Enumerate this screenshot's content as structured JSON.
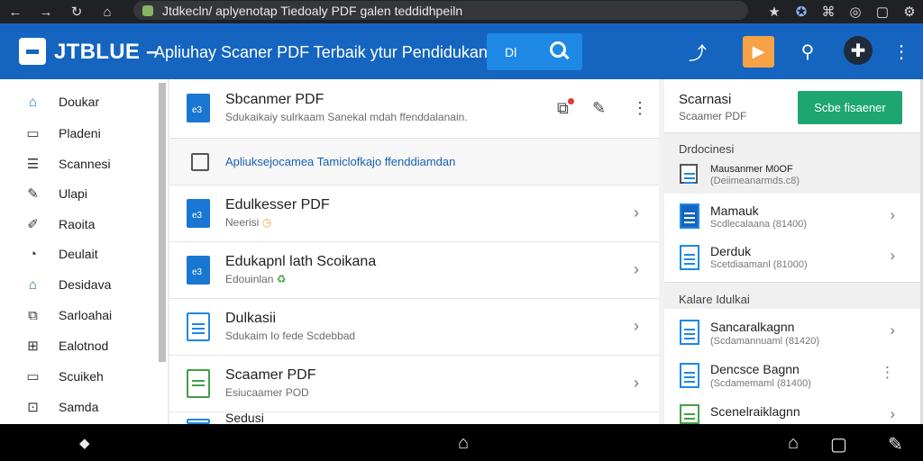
{
  "browser": {
    "back": "←",
    "forward": "→",
    "reload": "↻",
    "home": "⌂",
    "url": "Jtdkecln/ aplyenotap Tiedoaly PDF galen teddidhpeiln",
    "tools": [
      "★",
      "✪",
      "⌘",
      "◎",
      "▢",
      "⚙"
    ]
  },
  "app": {
    "brand": "JTBLUE –",
    "tagline": "Apliuhay Scaner PDF Terbaik ytur Pendidukan",
    "search_label": "Dl",
    "header_icons": {
      "share": "⤴",
      "orange": "▶",
      "key": "⚲",
      "puzzle": "✚",
      "more": "⋮"
    }
  },
  "sidebar": {
    "items": [
      {
        "label": "Doukar",
        "icon": "⌂",
        "color": "#1976d2"
      },
      {
        "label": "Pladeni",
        "icon": "▭",
        "color": "#333333"
      },
      {
        "label": "Scannesi",
        "icon": "☰",
        "color": "#333333"
      },
      {
        "label": "Ulapi",
        "icon": "✎",
        "color": "#333333"
      },
      {
        "label": "Raoita",
        "icon": "✐",
        "color": "#333333"
      },
      {
        "label": "Deulait",
        "icon": "◔",
        "color": "#333333"
      },
      {
        "label": "Desidava",
        "icon": "⌂",
        "color": "#2e7d32"
      },
      {
        "label": "Sarloahai",
        "icon": "⧉",
        "color": "#333333"
      },
      {
        "label": "Ealotnod",
        "icon": "⊞",
        "color": "#333333"
      },
      {
        "label": "Scuikeh",
        "icon": "▭",
        "color": "#333333"
      },
      {
        "label": "Samda",
        "icon": "⊡",
        "color": "#333333"
      }
    ]
  },
  "list": {
    "header": {
      "title": "Sbcanmer PDF",
      "subtitle": "Sdukaikaiy sulrkaam Sanekal mdah ffenddalanain.",
      "actions": [
        "⧉",
        "✎",
        "⋮"
      ]
    },
    "banner": "Apliuksejocamea Tamiclofkajo ffenddiamdan",
    "rows": [
      {
        "title": "Edulkesser PDF",
        "subtitle": "Neerisi",
        "badge": "◷",
        "icon": "blue"
      },
      {
        "title": "Edukapnl lath Scoikana",
        "subtitle": "Edouinlan",
        "badge": "♻",
        "icon": "blue"
      },
      {
        "title": "Dulkasii",
        "subtitle": "Sdukaim Io fede Scdebbad",
        "badge": "",
        "icon": "outline"
      },
      {
        "title": "Scaamer PDF",
        "subtitle": "Esiucaamer POD",
        "badge": "",
        "icon": "green"
      },
      {
        "title": "Sedusi",
        "subtitle": "",
        "badge": "",
        "icon": "outline"
      }
    ],
    "chevron": "›"
  },
  "right_panel": {
    "title": "Scarnasi",
    "subtitle": "Scaamer PDF",
    "button": "Scbe fisaener",
    "section1": "Drdocinesi",
    "featured": {
      "title": "Mausanmer M0OF",
      "subtitle": "(Deiimeanarmds.c8)"
    },
    "items1": [
      {
        "title": "Mamauk",
        "subtitle": "Scdlecalaana (81400)",
        "icon": "filled"
      },
      {
        "title": "Derduk",
        "subtitle": "Scetdiaamanl (81000)",
        "icon": "outline"
      }
    ],
    "section2": "Kalare Idulkai",
    "items2": [
      {
        "title": "Sancaralkagnn",
        "subtitle": "(Scdamannuaml (81420)",
        "icon": "outline",
        "action": "›"
      },
      {
        "title": "Dencsce Bagnn",
        "subtitle": "(Scdamemaml (81400)",
        "icon": "outline",
        "action": "⋮"
      },
      {
        "title": "Scenelraiklagnn",
        "subtitle": "",
        "icon": "green",
        "action": "›"
      }
    ]
  },
  "bottom_nav": {
    "left": "◆",
    "center": "⌂",
    "home": "⌂",
    "square": "▢",
    "tool": "✎"
  }
}
